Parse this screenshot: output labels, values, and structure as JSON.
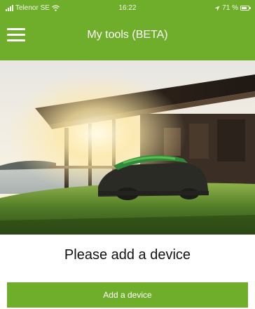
{
  "status_bar": {
    "carrier": "Telenor SE",
    "time": "16:22",
    "battery": "71 %",
    "battery_level_percent": 71,
    "icons": [
      "signal-icon",
      "wifi-icon",
      "location-icon",
      "battery-icon"
    ]
  },
  "header": {
    "title": "My tools (BETA)",
    "menu_icon": "hamburger-menu-icon"
  },
  "hero": {
    "image": "robotic lawn mower on grass in front of a wooden house at sunset by a lake"
  },
  "main": {
    "prompt": "Please add a device",
    "add_button_label": "Add a device"
  },
  "colors": {
    "brand_green": "#6fae2a",
    "text": "#111111",
    "background": "#ffffff"
  }
}
